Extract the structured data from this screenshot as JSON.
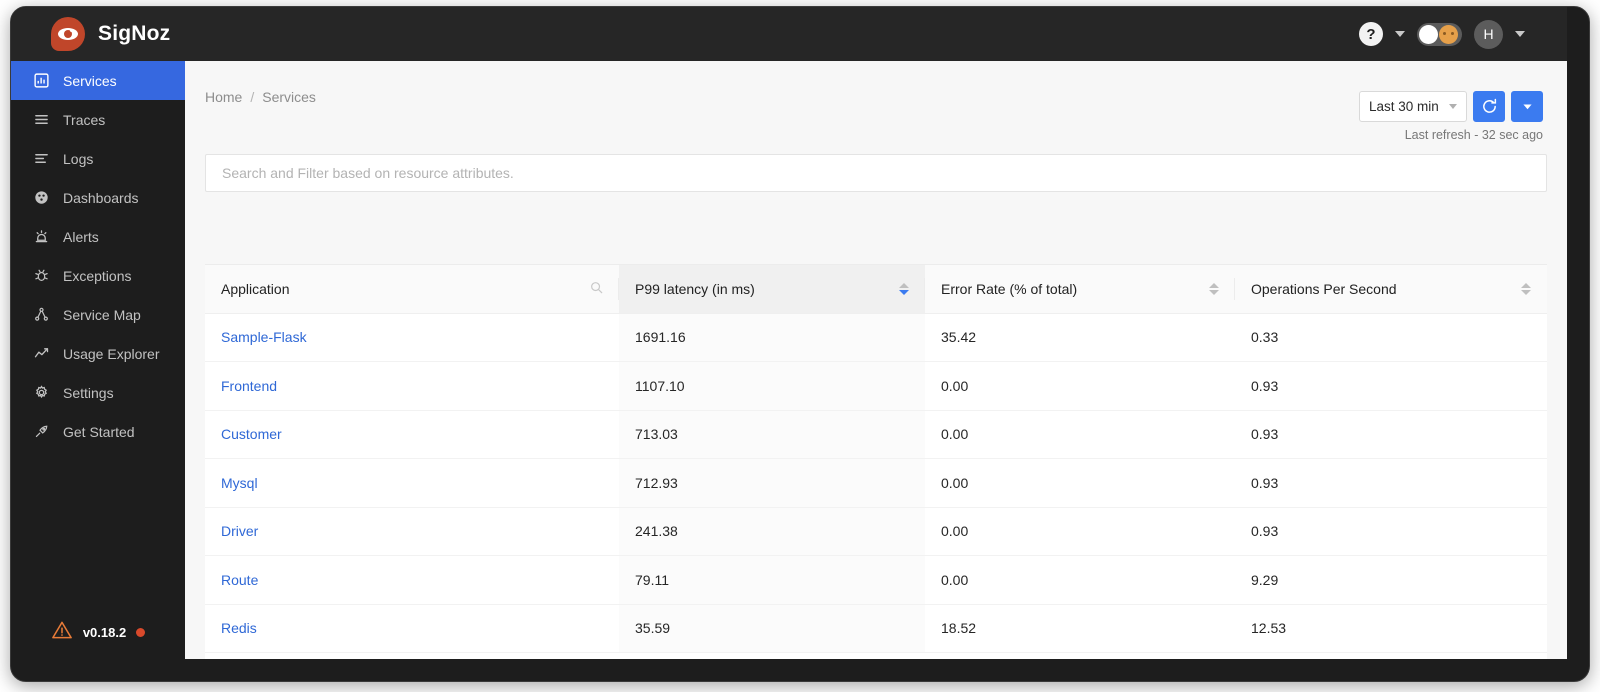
{
  "app": {
    "brand_name": "SigNoz",
    "brand_icon": "eye-logo-icon",
    "accent_blue": "#3b7bf0",
    "brand_orange": "#c0462a"
  },
  "topbar": {
    "help_label": "?",
    "help_icon": "question-mark-icon",
    "help_caret_icon": "chevron-down-icon",
    "theme_toggle_icon": "theme-toggle-switch",
    "theme_toggle_state": "light",
    "avatar_initial": "H",
    "avatar_caret_icon": "chevron-down-icon"
  },
  "sidebar": {
    "items": [
      {
        "label": "Services",
        "icon": "bar-chart-icon",
        "active": true
      },
      {
        "label": "Traces",
        "icon": "menu-lines-icon",
        "active": false
      },
      {
        "label": "Logs",
        "icon": "logs-lines-icon",
        "active": false
      },
      {
        "label": "Dashboards",
        "icon": "dashboard-grid-icon",
        "active": false
      },
      {
        "label": "Alerts",
        "icon": "alert-bell-icon",
        "active": false
      },
      {
        "label": "Exceptions",
        "icon": "bug-icon",
        "active": false
      },
      {
        "label": "Service Map",
        "icon": "node-graph-icon",
        "active": false
      },
      {
        "label": "Usage Explorer",
        "icon": "line-chart-icon",
        "active": false
      },
      {
        "label": "Settings",
        "icon": "gear-icon",
        "active": false
      },
      {
        "label": "Get Started",
        "icon": "rocket-icon",
        "active": false
      }
    ],
    "version": {
      "warning_icon": "warning-triangle-icon",
      "label": "v0.18.2",
      "status_dot_color": "#d8492b"
    }
  },
  "breadcrumb": {
    "home": "Home",
    "separator": "/",
    "current": "Services"
  },
  "time_controls": {
    "selected_range": "Last 30 min",
    "range_caret_icon": "chevron-down-icon",
    "refresh_icon": "refresh-circle-icon",
    "dropdown_icon": "caret-down-icon",
    "refresh_note": "Last refresh - 32 sec ago"
  },
  "search": {
    "placeholder": "Search and Filter based on resource attributes.",
    "value": ""
  },
  "table": {
    "columns": [
      {
        "label": "Application",
        "icon": "search-icon",
        "sortable": false
      },
      {
        "label": "P99 latency (in ms)",
        "sortable": true,
        "sort": "desc"
      },
      {
        "label": "Error Rate (% of total)",
        "sortable": true,
        "sort": "none"
      },
      {
        "label": "Operations Per Second",
        "sortable": true,
        "sort": "none"
      }
    ],
    "rows": [
      {
        "application": "Sample-Flask",
        "p99": "1691.16",
        "error_rate": "35.42",
        "ops": "0.33"
      },
      {
        "application": "Frontend",
        "p99": "1107.10",
        "error_rate": "0.00",
        "ops": "0.93"
      },
      {
        "application": "Customer",
        "p99": "713.03",
        "error_rate": "0.00",
        "ops": "0.93"
      },
      {
        "application": "Mysql",
        "p99": "712.93",
        "error_rate": "0.00",
        "ops": "0.93"
      },
      {
        "application": "Driver",
        "p99": "241.38",
        "error_rate": "0.00",
        "ops": "0.93"
      },
      {
        "application": "Route",
        "p99": "79.11",
        "error_rate": "0.00",
        "ops": "9.29"
      },
      {
        "application": "Redis",
        "p99": "35.59",
        "error_rate": "18.52",
        "ops": "12.53"
      }
    ]
  }
}
